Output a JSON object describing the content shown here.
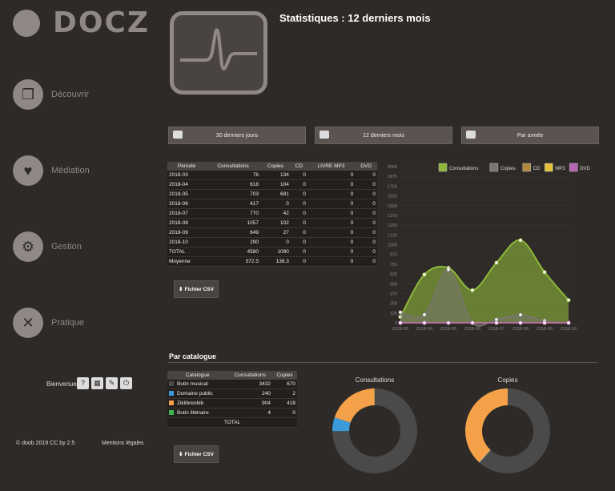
{
  "app": {
    "logo_text": "DOCZ"
  },
  "sidebar": {
    "items": [
      {
        "label": "Découvrir",
        "icon": "windows-icon"
      },
      {
        "label": "Médiation",
        "icon": "heart-icon"
      },
      {
        "label": "Gestion",
        "icon": "gear-icon"
      },
      {
        "label": "Pratique",
        "icon": "tools-icon"
      }
    ],
    "welcome": "Bienvenue",
    "footer_left": "© doob 2019 CC by 2.5",
    "footer_right": "Mentions légales"
  },
  "header": {
    "title": "Statistiques : 12 derniers mois"
  },
  "tabs": [
    {
      "label": "30 derniers jours"
    },
    {
      "label": "12 derniers mois"
    },
    {
      "label": "Par année"
    }
  ],
  "stats_table": {
    "headers": [
      "Période",
      "Consultations",
      "Copies",
      "CD",
      "LIVRE MP3",
      "DVD"
    ],
    "rows": [
      [
        "2018-03",
        "76",
        "134",
        "0",
        "0",
        "0"
      ],
      [
        "2018-04",
        "618",
        "104",
        "0",
        "0",
        "0"
      ],
      [
        "2018-05",
        "703",
        "681",
        "0",
        "0",
        "0"
      ],
      [
        "2018-06",
        "417",
        "0",
        "0",
        "0",
        "0"
      ],
      [
        "2018-07",
        "770",
        "42",
        "0",
        "0",
        "0"
      ],
      [
        "2018-08",
        "1057",
        "102",
        "0",
        "0",
        "0"
      ],
      [
        "2018-09",
        "649",
        "27",
        "0",
        "0",
        "0"
      ],
      [
        "2018-10",
        "290",
        "0",
        "0",
        "0",
        "0"
      ],
      [
        "TOTAL",
        "4580",
        "1090",
        "0",
        "0",
        "0"
      ],
      [
        "Moyenne",
        "572.5",
        "136.3",
        "0",
        "0",
        "0"
      ]
    ]
  },
  "csv_label": "Fichier CSV",
  "catalogue": {
    "section_title": "Par catalogue",
    "headers": [
      "Catalogue",
      "Consultations",
      "Copies"
    ],
    "rows": [
      {
        "name": "Butin musical",
        "consultations": "3432",
        "copies": "670",
        "color": "#4a4a4a"
      },
      {
        "name": "Domaine public",
        "consultations": "240",
        "copies": "2",
        "color": "#3b9ad9"
      },
      {
        "name": "Ziklibrenbib",
        "consultations": "904",
        "copies": "418",
        "color": "#f5a14a"
      },
      {
        "name": "Butin littéraire",
        "consultations": "4",
        "copies": "0",
        "color": "#3cb44b"
      }
    ],
    "total_label": "TOTAL",
    "donut_consultations_title": "Consultations",
    "donut_copies_title": "Copies"
  },
  "chart_data": {
    "type": "area",
    "x": [
      "2018-03",
      "2018-04",
      "2018-05",
      "2018-06",
      "2018-07",
      "2018-08",
      "2018-09",
      "2018-10"
    ],
    "yticks": [
      "0",
      "125",
      "250",
      "375",
      "500",
      "625",
      "750",
      "875",
      "1000",
      "1125",
      "1250",
      "1375",
      "1500",
      "1625",
      "1750",
      "1875",
      "2000"
    ],
    "ylim": [
      0,
      2000
    ],
    "legend_position": "top-right",
    "series": [
      {
        "name": "Consultations",
        "values": [
          76,
          618,
          703,
          417,
          770,
          1057,
          649,
          290
        ],
        "color": "#8db83a"
      },
      {
        "name": "Copies",
        "values": [
          134,
          104,
          681,
          0,
          42,
          102,
          27,
          0
        ],
        "color": "#7a7572"
      },
      {
        "name": "CD",
        "values": [
          0,
          0,
          0,
          0,
          0,
          0,
          0,
          0
        ],
        "color": "#b08a3e"
      },
      {
        "name": "MP3",
        "values": [
          0,
          0,
          0,
          0,
          0,
          0,
          0,
          0
        ],
        "color": "#e5c13a"
      },
      {
        "name": "DVD",
        "values": [
          0,
          0,
          0,
          0,
          0,
          0,
          0,
          0
        ],
        "color": "#b565b5"
      }
    ]
  }
}
